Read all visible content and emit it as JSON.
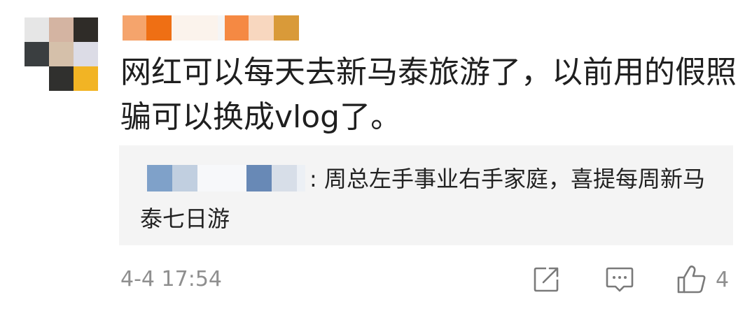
{
  "avatar": {
    "pixels": [
      "#e6e6e6",
      "#d4b4a2",
      "#2f2c28",
      "#3a3e40",
      "#d5c0aa",
      "#dcdce6",
      "#ffffff",
      "#30302e",
      "#f2b424"
    ]
  },
  "post": {
    "username_blocks": [
      "#f5a46c",
      "#ef6f14",
      "#fbf3ec",
      "#f5f5f5",
      "#f58943",
      "#f8d7bf",
      "#d99a39"
    ],
    "comment_text": "网红可以每天去新马泰旅游了，以前用的假照骗可以换成vlog了。"
  },
  "reply": {
    "name_blocks": [
      "#7fa1c9",
      "#c1cfe0",
      "#f7f8fa",
      "#6889b6",
      "#d7dee8",
      "#ecf0f5"
    ],
    "text": ": 周总左手事业右手家庭，喜提每周新马泰七日游"
  },
  "footer": {
    "timestamp": "4-4 17:54",
    "like_count": "4",
    "icons": [
      "share-icon",
      "comment-icon",
      "like-icon"
    ]
  }
}
